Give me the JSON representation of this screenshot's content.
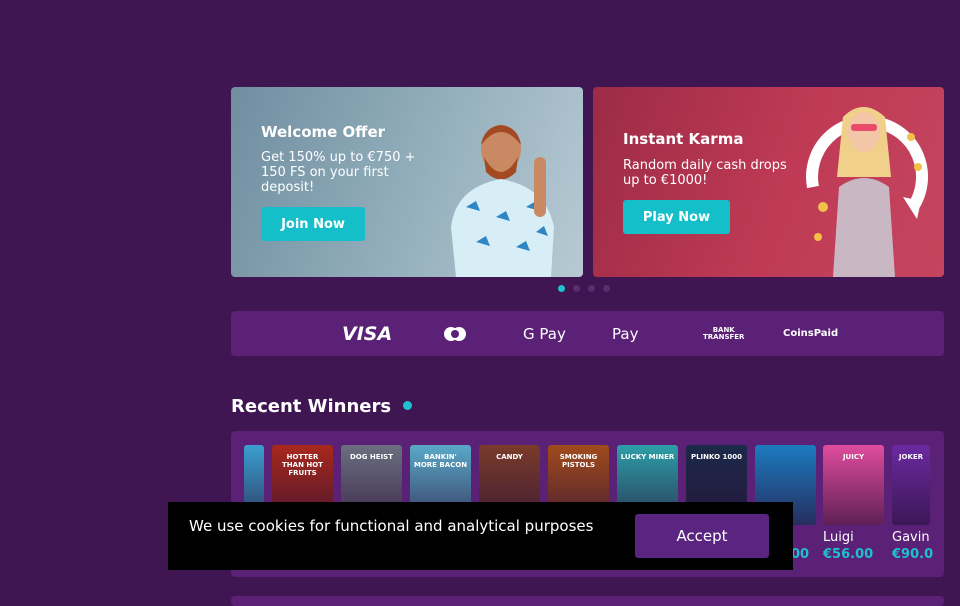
{
  "banners": [
    {
      "title": "Welcome Offer",
      "text": "Get 150% up to €750 + 150 FS on your first deposit!",
      "button": "Join Now"
    },
    {
      "title": "Instant Karma",
      "text": "Random daily cash drops up to €1000!",
      "button": "Play Now"
    }
  ],
  "carousel": {
    "count": 4,
    "active": 0
  },
  "payments": [
    "VISA",
    "",
    "G Pay",
    " Pay",
    "BANK TRANSFER",
    "CoinsPaid"
  ],
  "recent_winners": {
    "title": "Recent Winners",
    "games": [
      {
        "label": "",
        "color": "#3aa0d0"
      },
      {
        "label": "HOTTER THAN HOT FRUITS",
        "color": "#a8281c"
      },
      {
        "label": "DOG HEIST",
        "color": "#6b6f80"
      },
      {
        "label": "BANKIN' MORE BACON",
        "color": "#5aa9c9"
      },
      {
        "label": "CANDY",
        "color": "#7a3b2a"
      },
      {
        "label": "SMOKING PISTOLS",
        "color": "#a14b1d"
      },
      {
        "label": "LUCKY MINER",
        "color": "#2c9fa8"
      },
      {
        "label": "PLINKO 1000",
        "color": "#1c2a4a"
      },
      {
        "label": "",
        "color": "#1b7bbf"
      },
      {
        "label": "JUICY",
        "color": "#e04c9d"
      },
      {
        "label": "JOKER",
        "color": "#6a2aa0"
      }
    ],
    "winners": [
      {
        "name": "",
        "amount": "00"
      },
      {
        "name": "Luigi",
        "amount": "€56.00"
      },
      {
        "name": "Gavin",
        "amount": "€90.0"
      }
    ]
  },
  "cookie": {
    "text": "We use cookies for functional and analytical purposes",
    "button": "Accept"
  }
}
